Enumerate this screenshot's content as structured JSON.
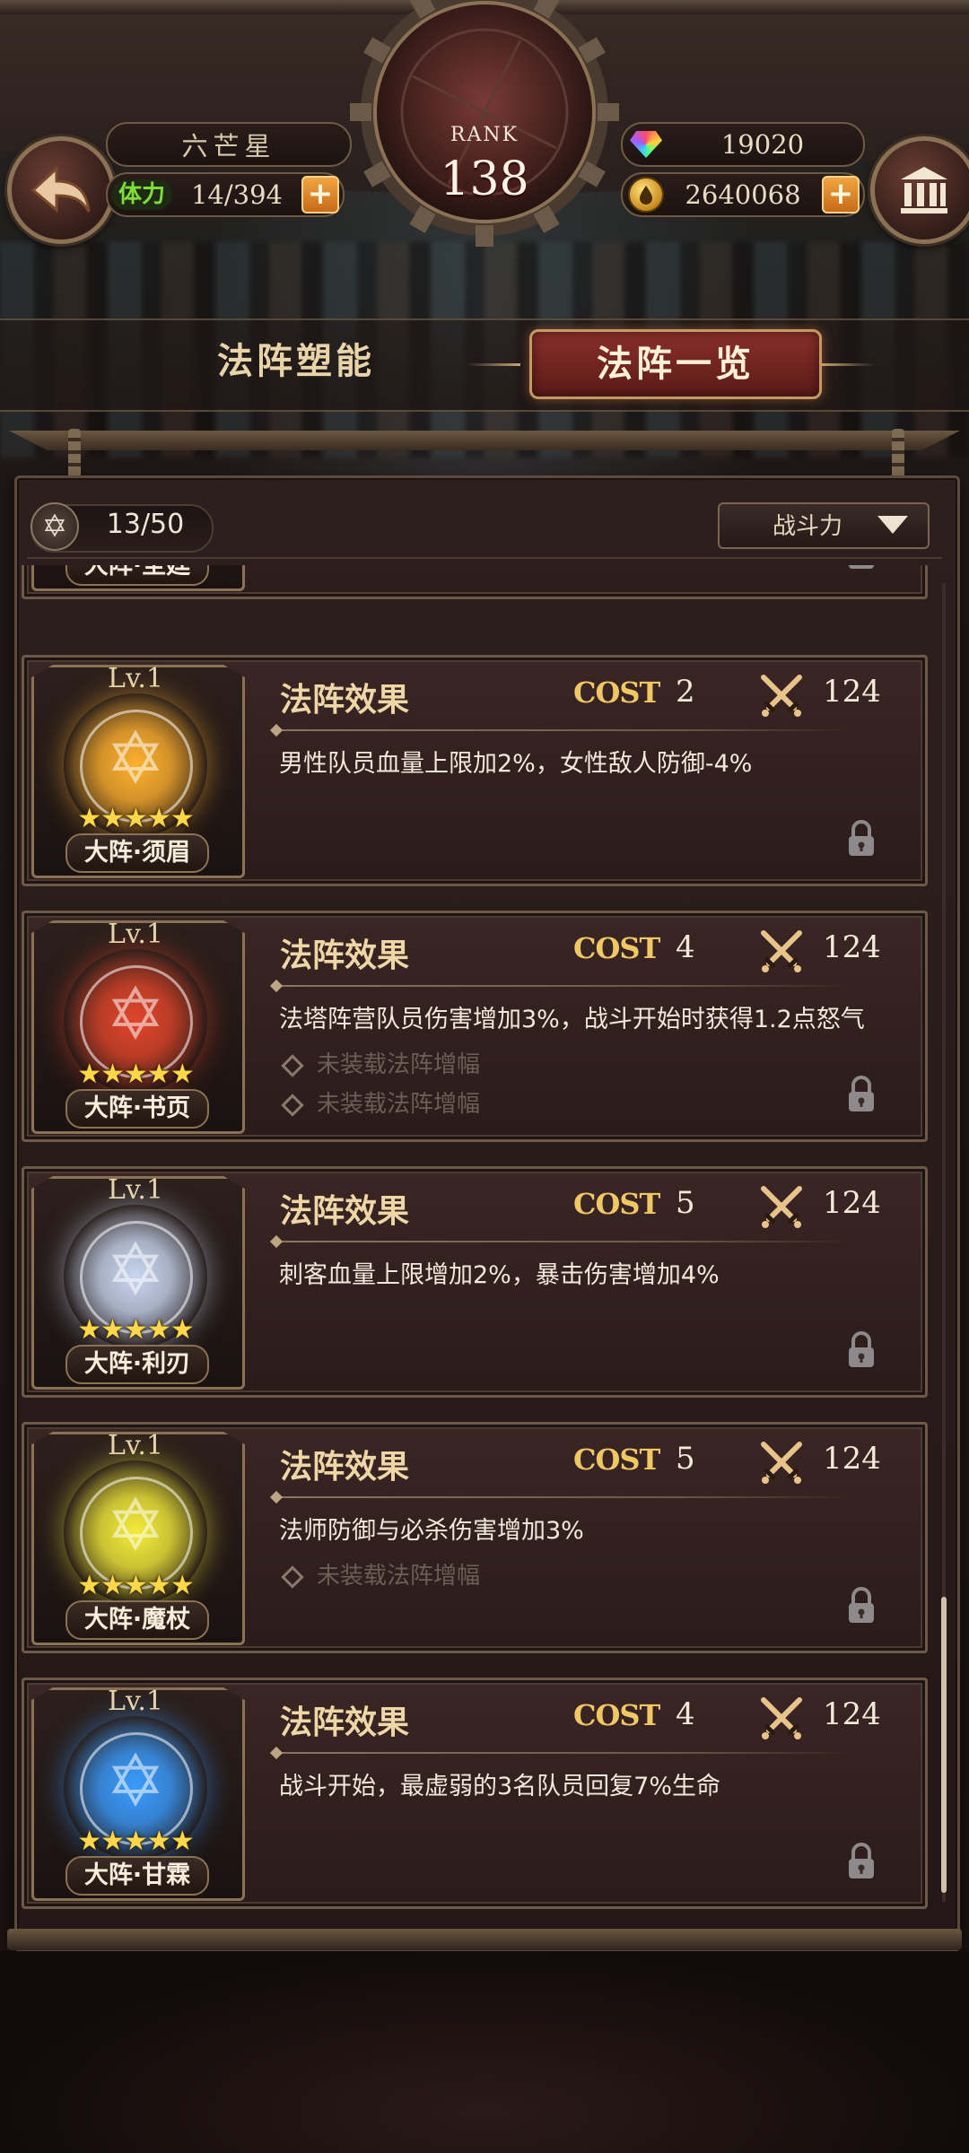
{
  "header": {
    "player_name": "六芒星",
    "stamina_label": "体力",
    "stamina": "14/394",
    "rank_label": "RANK",
    "rank": "138",
    "gems": "19020",
    "coins": "2640068",
    "plus": "+"
  },
  "tabs": [
    {
      "label": "法阵塑能",
      "active": false
    },
    {
      "label": "法阵一览",
      "active": true
    }
  ],
  "list_header": {
    "count": "13/50",
    "sort_label": "战斗力"
  },
  "colors": {
    "accent": "#c49a62",
    "active_tab": "#8a2f29",
    "cost_gold": "#f0c765",
    "star": "#ffd74a"
  },
  "arrays": {
    "cards": [
      {
        "level": "",
        "name": "大阵·圣廷",
        "orb_color": "#c9b48a",
        "effect_title": "",
        "cost_label": "",
        "cost": "",
        "power": "",
        "effect_text": "",
        "slots": [],
        "locked": true,
        "stars": 5
      },
      {
        "level": "Lv.1",
        "name": "大阵·须眉",
        "orb_color": "#ffb02e",
        "effect_title": "法阵效果",
        "cost_label": "COST",
        "cost": "2",
        "power": "124",
        "effect_text": "男性队员血量上限加2%，女性敌人防御-4%",
        "slots": [],
        "locked": true,
        "stars": 5
      },
      {
        "level": "Lv.1",
        "name": "大阵·书页",
        "orb_color": "#e0452a",
        "effect_title": "法阵效果",
        "cost_label": "COST",
        "cost": "4",
        "power": "124",
        "effect_text": "法塔阵营队员伤害增加3%，战斗开始时获得1.2点怒气",
        "slots": [
          "未装载法阵增幅",
          "未装载法阵增幅"
        ],
        "locked": true,
        "stars": 5
      },
      {
        "level": "Lv.1",
        "name": "大阵·利刃",
        "orb_color": "#c8d6f0",
        "effect_title": "法阵效果",
        "cost_label": "COST",
        "cost": "5",
        "power": "124",
        "effect_text": "刺客血量上限增加2%，暴击伤害增加4%",
        "slots": [],
        "locked": true,
        "stars": 5
      },
      {
        "level": "Lv.1",
        "name": "大阵·魔杖",
        "orb_color": "#f4ec3a",
        "effect_title": "法阵效果",
        "cost_label": "COST",
        "cost": "5",
        "power": "124",
        "effect_text": "法师防御与必杀伤害增加3%",
        "slots": [
          "未装载法阵增幅"
        ],
        "locked": true,
        "stars": 5
      },
      {
        "level": "Lv.1",
        "name": "大阵·甘霖",
        "orb_color": "#3a9cff",
        "effect_title": "法阵效果",
        "cost_label": "COST",
        "cost": "4",
        "power": "124",
        "effect_text": "战斗开始，最虚弱的3名队员回复7%生命",
        "slots": [],
        "locked": true,
        "stars": 5
      }
    ]
  }
}
